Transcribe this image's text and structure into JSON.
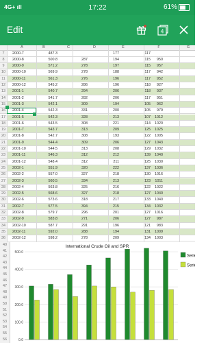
{
  "status_bar": {
    "signal": "4G+ ıll",
    "time": "17:22",
    "battery": "61%"
  },
  "app_bar": {
    "title": "Edit",
    "tabs_count": "4"
  },
  "sheet": {
    "columns": [
      "A",
      "B",
      "C",
      "D",
      "E",
      "F",
      "G"
    ],
    "rows": [
      {
        "n": "7",
        "a": "2000-7",
        "b": "487.3",
        "c": "",
        "d": "177",
        "e": "117",
        "f": "",
        "alt": false
      },
      {
        "n": "8",
        "a": "2000-8",
        "b": "500.8",
        "c": "287",
        "d": "194",
        "e": "115",
        "f": "950",
        "alt": false
      },
      {
        "n": "9",
        "a": "2000-9",
        "b": "571.2",
        "c": "278",
        "d": "197",
        "e": "115",
        "f": "957",
        "alt": true
      },
      {
        "n": "10",
        "a": "2000-10",
        "b": "569.9",
        "c": "278",
        "d": "188",
        "e": "117",
        "f": "942",
        "alt": false
      },
      {
        "n": "11",
        "a": "2000-11",
        "b": "561.3",
        "c": "276",
        "d": "196",
        "e": "117",
        "f": "952",
        "alt": true
      },
      {
        "n": "12",
        "a": "2000-12",
        "b": "545.2",
        "c": "286",
        "d": "196",
        "e": "118",
        "f": "927",
        "alt": false
      },
      {
        "n": "13",
        "a": "2001-1",
        "b": "540.7",
        "c": "294",
        "d": "206",
        "e": "118",
        "f": "937",
        "alt": true
      },
      {
        "n": "14",
        "a": "2001-2",
        "b": "541.7",
        "c": "282",
        "d": "206",
        "e": "117",
        "f": "951",
        "alt": false
      },
      {
        "n": "15",
        "a": "2001-3",
        "b": "542.1",
        "c": "309",
        "d": "194",
        "e": "105",
        "f": "962",
        "alt": true
      },
      {
        "n": "16",
        "a": "2001-4",
        "b": "542.3",
        "c": "331",
        "d": "200",
        "e": "105",
        "f": "979",
        "alt": false
      },
      {
        "n": "17",
        "a": "2001-5",
        "b": "542.3",
        "c": "328",
        "d": "213",
        "e": "107",
        "f": "1012",
        "alt": true
      },
      {
        "n": "18",
        "a": "2001-6",
        "b": "543.5",
        "c": "308",
        "d": "221",
        "e": "114",
        "f": "1020",
        "alt": false
      },
      {
        "n": "19",
        "a": "2001-7",
        "b": "543.7",
        "c": "313",
        "d": "209",
        "e": "125",
        "f": "1025",
        "alt": true
      },
      {
        "n": "20",
        "a": "2001-8",
        "b": "542.7",
        "c": "308",
        "d": "193",
        "e": "122",
        "f": "1005",
        "alt": false
      },
      {
        "n": "21",
        "a": "2001-9",
        "b": "544.4",
        "c": "309",
        "d": "206",
        "e": "127",
        "f": "1043",
        "alt": true
      },
      {
        "n": "22",
        "a": "2001-10",
        "b": "544.5",
        "c": "313",
        "d": "208",
        "e": "129",
        "f": "1032",
        "alt": false
      },
      {
        "n": "23",
        "a": "2001-11",
        "b": "546.3",
        "c": "312",
        "d": "212",
        "e": "139",
        "f": "1040",
        "alt": true
      },
      {
        "n": "24",
        "a": "2001-12",
        "b": "548.4",
        "c": "312",
        "d": "211",
        "e": "125",
        "f": "1030",
        "alt": false
      },
      {
        "n": "25",
        "a": "2002-1",
        "b": "551.9",
        "c": "320",
        "d": "222",
        "e": "137",
        "f": "1036",
        "alt": true
      },
      {
        "n": "26",
        "a": "2002-2",
        "b": "557.0",
        "c": "327",
        "d": "218",
        "e": "130",
        "f": "1016",
        "alt": false
      },
      {
        "n": "27",
        "a": "2002-3",
        "b": "560.5",
        "c": "334",
        "d": "213",
        "e": "123",
        "f": "1011",
        "alt": true
      },
      {
        "n": "28",
        "a": "2002-4",
        "b": "563.8",
        "c": "325",
        "d": "216",
        "e": "122",
        "f": "1022",
        "alt": false
      },
      {
        "n": "29",
        "a": "2002-5",
        "b": "568.6",
        "c": "327",
        "d": "218",
        "e": "127",
        "f": "1040",
        "alt": true
      },
      {
        "n": "30",
        "a": "2002-6",
        "b": "573.6",
        "c": "318",
        "d": "217",
        "e": "133",
        "f": "1040",
        "alt": false
      },
      {
        "n": "31",
        "a": "2002-7",
        "b": "577.5",
        "c": "394",
        "d": "215",
        "e": "134",
        "f": "1032",
        "alt": true
      },
      {
        "n": "32",
        "a": "2002-8",
        "b": "579.7",
        "c": "296",
        "d": "201",
        "e": "127",
        "f": "1016",
        "alt": false
      },
      {
        "n": "33",
        "a": "2002-9",
        "b": "583.8",
        "c": "271",
        "d": "206",
        "e": "127",
        "f": "987",
        "alt": true
      },
      {
        "n": "34",
        "a": "2002-10",
        "b": "587.7",
        "c": "291",
        "d": "196",
        "e": "121",
        "f": "983",
        "alt": false
      },
      {
        "n": "35",
        "a": "2002-11",
        "b": "592.0",
        "c": "288",
        "d": "194",
        "e": "131",
        "f": "1009",
        "alt": true
      },
      {
        "n": "36",
        "a": "2002-12",
        "b": "598.2",
        "c": "278",
        "d": "209",
        "e": "134",
        "f": "1003",
        "alt": false
      },
      {
        "n": "37",
        "a": "2003-1",
        "b": "599.2",
        "c": "274",
        "d": "211",
        "e": "113",
        "f": "945",
        "alt": true
      },
      {
        "n": "38",
        "a": "2003-2",
        "b": "599.2",
        "c": "271",
        "d": "203",
        "e": "96",
        "f": "861",
        "alt": false
      },
      {
        "n": "39",
        "a": "2003-3",
        "b": "599.8",
        "c": "274",
        "d": "200",
        "e": "96",
        "f": "875",
        "alt": true
      }
    ],
    "lower_row_numbers": [
      "40",
      "41",
      "42",
      "43",
      "44",
      "45",
      "46",
      "47",
      "48",
      "49",
      "50",
      "51",
      "52",
      "53",
      "54",
      "55",
      "56"
    ]
  },
  "chart_data": {
    "type": "bar",
    "title": "International Crude Oil and SPR",
    "categories": [
      "1",
      "2",
      "3",
      "4",
      "5",
      "6",
      "7",
      "8"
    ],
    "ylim": [
      0,
      500
    ],
    "yticks": [
      "0.0",
      "100.0",
      "200.0",
      "300.0",
      "400.0",
      "500.0"
    ],
    "series": [
      {
        "name": "Serie",
        "color": "#1f8a2e",
        "values": [
          305,
          315,
          370,
          425,
          465,
          515,
          520,
          505
        ]
      },
      {
        "name": "Serie",
        "color": "#c5df3b",
        "values": [
          225,
          285,
          245,
          305,
          300,
          270,
          280,
          285
        ]
      }
    ],
    "legend_position": "right",
    "grid": true
  },
  "colors": {
    "accent": "#21a35a",
    "alt_row": "#d8e7c6"
  }
}
